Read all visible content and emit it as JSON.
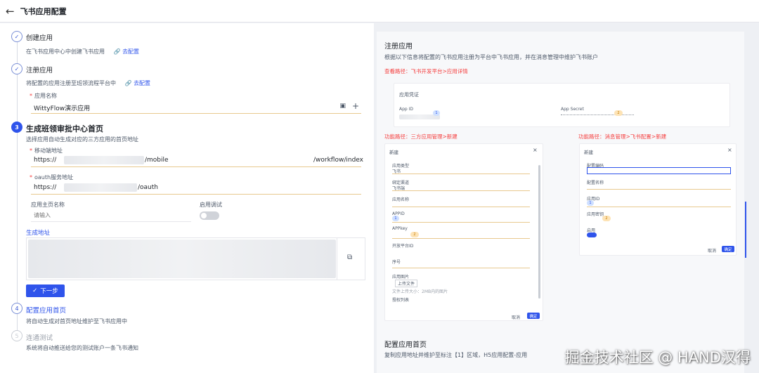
{
  "header": {
    "title": "飞书应用配置"
  },
  "steps": [
    {
      "num": "1",
      "title": "创建应用",
      "desc": "在飞书应用中心中创建飞书应用",
      "link": "去配置"
    },
    {
      "num": "2",
      "title": "注册应用",
      "desc": "将配置的应用注册至班领流程平台中",
      "link": "去配置"
    },
    {
      "num": "3",
      "title": "生成班领审批中心首页",
      "desc": "选择应用自动生成对应的三方应用的首页地址"
    },
    {
      "num": "4",
      "title": "配置应用首页",
      "desc": "将自动生成对首页地址维护至飞书应用中"
    },
    {
      "num": "5",
      "title": "连通测试",
      "desc": "系统将自动推送给您的测试账户一条飞书通知"
    }
  ],
  "form": {
    "app_name_label": "应用名称",
    "app_name_value": "WittyFlow演示应用",
    "mobile_label": "移动端地址",
    "mobile_prefix": "https://",
    "mobile_mid": "/mobile",
    "mobile_suffix": "/workflow/index",
    "oauth_label": "oauth服务地址",
    "oauth_prefix": "https://",
    "oauth_suffix": "/oauth",
    "home_name_label": "应用主页名称",
    "home_name_placeholder": "请输入",
    "debug_label": "启用调试",
    "gen_label": "生成地址",
    "next_button": "下一步"
  },
  "right": {
    "title": "注册应用",
    "desc": "根据以下信息将配置的飞书应用注册为平台中飞书应用，并在消息管理中维护飞书账户",
    "path": "查看路径：飞书开发平台>应用详情",
    "cred_title": "应用凭证",
    "app_id_label": "App ID",
    "app_secret_label": "App Secret",
    "path_left": "功能路径：三方应用管理>新建",
    "path_right": "功能路径：消息管理>飞书配置>新建",
    "modal_title": "新建",
    "left_fields": [
      "应用类型",
      "飞书",
      "绑定渠道",
      "飞书端",
      "应用名称",
      "APPID",
      "APPkey",
      "开放平台ID",
      "序号",
      "应用图片",
      "上传文件",
      "文件上传大小：2MB内的图片",
      "授权列表"
    ],
    "right_fields": [
      "配置编码",
      "配置名称",
      "应用ID",
      "应用密钥",
      "启用"
    ],
    "cancel": "取消",
    "ok": "确定",
    "bottom_title": "配置应用首页",
    "bottom_desc": "复制应用地址并维护至标注【1】区域，H5应用配置-应用"
  },
  "watermark": "掘金技术社区 @ HAND汉得",
  "colors": {
    "accent": "#2f54eb",
    "required": "#f53f3f",
    "underline": "#e8c98f"
  }
}
